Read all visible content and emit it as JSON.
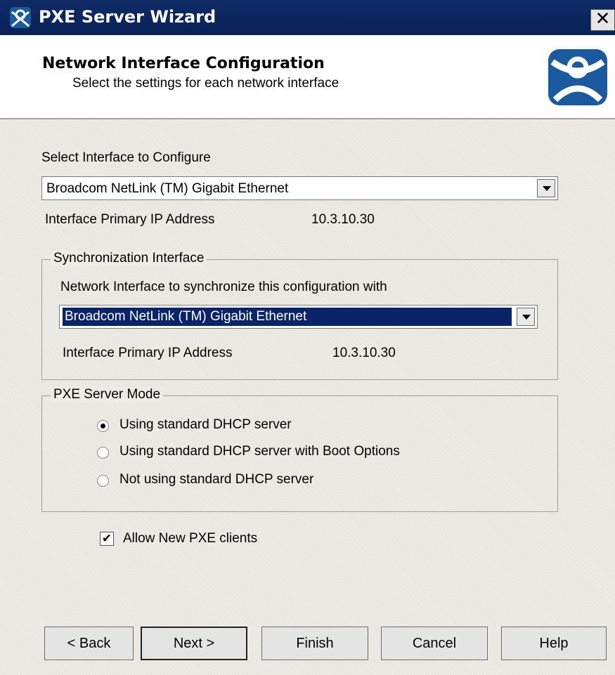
{
  "window": {
    "title": "PXE Server Wizard",
    "close_glyph": "✕"
  },
  "header": {
    "title": "Network Interface Configuration",
    "subtitle": "Select the settings for each network interface",
    "logo_icon": "thinmanager-person-icon"
  },
  "interface": {
    "select_label": "Select Interface to Configure",
    "selected": "Broadcom NetLink (TM) Gigabit Ethernet",
    "ip_label": "Interface Primary IP Address",
    "ip_value": "10.3.10.30"
  },
  "sync": {
    "group_label": "Synchronization Interface",
    "prompt": "Network Interface to synchronize this configuration with",
    "selected": "Broadcom NetLink (TM) Gigabit Ethernet",
    "ip_label": "Interface Primary IP Address",
    "ip_value": "10.3.10.30"
  },
  "mode": {
    "group_label": "PXE Server Mode",
    "options": [
      {
        "label": "Using standard DHCP server",
        "selected": true
      },
      {
        "label": "Using standard DHCP server with Boot Options",
        "selected": false
      },
      {
        "label": "Not using standard DHCP server",
        "selected": false
      }
    ]
  },
  "allow_new": {
    "label": "Allow New PXE clients",
    "checked": true,
    "mark": "✔"
  },
  "buttons": {
    "back": "< Back",
    "next": "Next >",
    "finish": "Finish",
    "cancel": "Cancel",
    "help": "Help"
  },
  "colors": {
    "titlebar": "#0a2259",
    "selection": "#0a246a",
    "logo_blue": "#1b5a9e"
  }
}
